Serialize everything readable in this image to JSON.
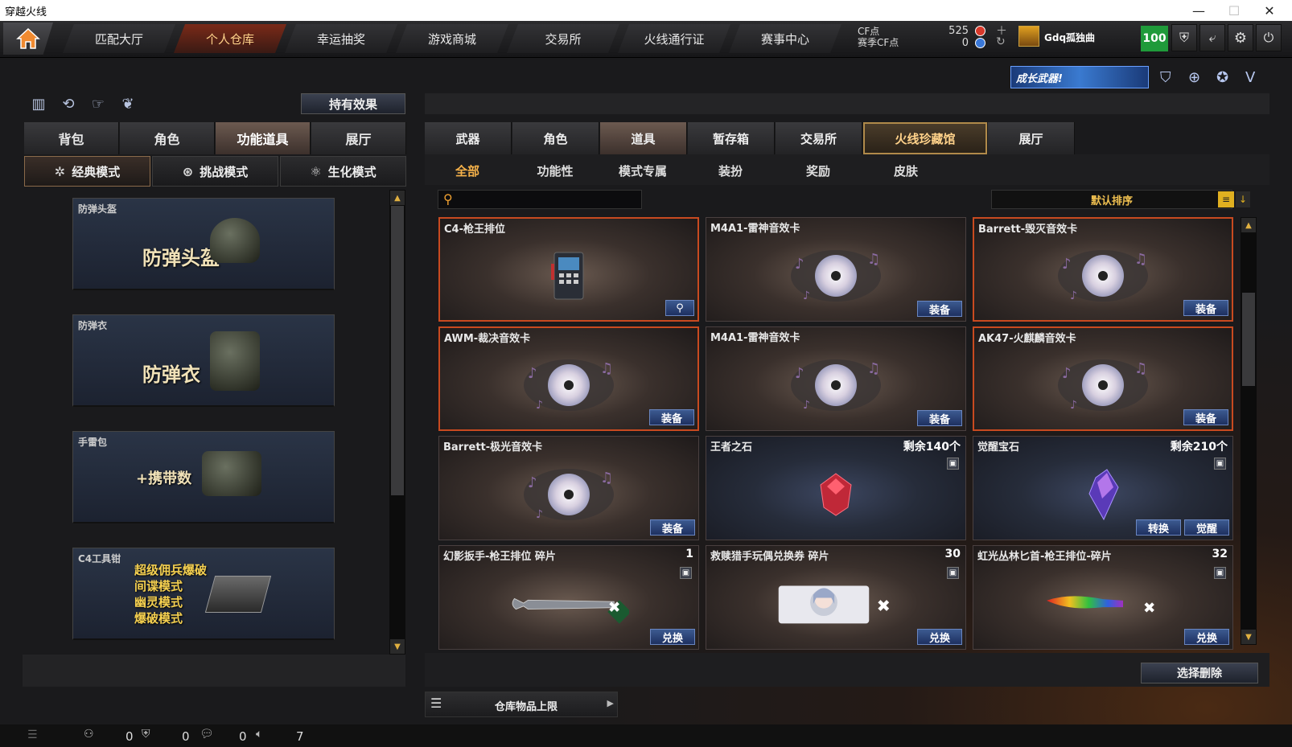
{
  "window": {
    "title": "穿越火线",
    "controls": [
      "—",
      "☐",
      "✕"
    ]
  },
  "nav": {
    "tabs": [
      "匹配大厅",
      "个人仓库",
      "幸运抽奖",
      "游戏商城",
      "交易所",
      "火线通行证",
      "赛事中心"
    ],
    "active_index": 1,
    "cf_label": "CF点",
    "season_cf_label": "赛季CF点",
    "cf_value": "525",
    "season_cf_value": "0",
    "username": "Gdq孤独曲",
    "level": "100",
    "colors": {
      "active_tab": "#7a2a18",
      "level_bg": "#1f9a3a"
    }
  },
  "banner": {
    "text": "成长武器!"
  },
  "left": {
    "hold_effect_button": "持有效果",
    "tabs": [
      "背包",
      "角色",
      "功能道具",
      "展厅"
    ],
    "active_tab": 2,
    "modes": [
      "经典模式",
      "挑战模式",
      "生化模式"
    ],
    "active_mode": 0,
    "cards": [
      {
        "caption": "防弹头盔",
        "big": "防弹头盔"
      },
      {
        "caption": "防弹衣",
        "big": "防弹衣"
      },
      {
        "caption": "手雷包",
        "big": "+携带数"
      },
      {
        "caption": "C4工具钳",
        "lines": [
          "超级佣兵爆破",
          "间谍模式",
          "幽灵模式",
          "爆破模式"
        ]
      }
    ]
  },
  "right": {
    "tabs": [
      "武器",
      "角色",
      "道具",
      "暂存箱",
      "交易所",
      "火线珍藏馆",
      "展厅"
    ],
    "active_tab": 2,
    "gold_tab": 5,
    "subtabs": [
      "全部",
      "功能性",
      "模式专属",
      "装扮",
      "奖励",
      "皮肤"
    ],
    "active_subtab": 0,
    "search_placeholder": "",
    "sort_label": "默认排序",
    "items": [
      {
        "name": "C4-枪王排位",
        "button": "",
        "count": "",
        "type": "c4",
        "sel": true
      },
      {
        "name": "M4A1-雷神音效卡",
        "button": "装备",
        "count": "",
        "type": "disc",
        "sel": false
      },
      {
        "name": "Barrett-毁灭音效卡",
        "button": "装备",
        "count": "",
        "type": "disc",
        "sel": true
      },
      {
        "name": "AWM-裁决音效卡",
        "button": "装备",
        "count": "",
        "type": "disc",
        "sel": true
      },
      {
        "name": "M4A1-雷神音效卡",
        "button": "装备",
        "count": "",
        "type": "disc",
        "sel": false
      },
      {
        "name": "AK47-火麒麟音效卡",
        "button": "装备",
        "count": "",
        "type": "disc",
        "sel": true
      },
      {
        "name": "Barrett-极光音效卡",
        "button": "装备",
        "count": "",
        "type": "disc",
        "sel": false
      },
      {
        "name": "王者之石",
        "button": "",
        "count": "剩余140个",
        "type": "redgem",
        "sel": false
      },
      {
        "name": "觉醒宝石",
        "button": "觉醒",
        "button2": "转换",
        "count": "剩余210个",
        "type": "bluegem",
        "sel": false
      },
      {
        "name": "幻影扳手-枪王排位 碎片",
        "button": "兑换",
        "count": "1",
        "type": "wrench",
        "sel": false
      },
      {
        "name": "救赎猎手玩偶兑换券 碎片",
        "button": "兑换",
        "count": "30",
        "type": "ticket",
        "sel": false
      },
      {
        "name": "虹光丛林匕首-枪王排位-碎片",
        "button": "兑换",
        "count": "32",
        "type": "knife",
        "sel": false
      }
    ],
    "select_delete": "选择删除",
    "storage_limit": "仓库物品上限"
  },
  "status": {
    "values": [
      "0",
      "0",
      "0",
      "7"
    ]
  }
}
